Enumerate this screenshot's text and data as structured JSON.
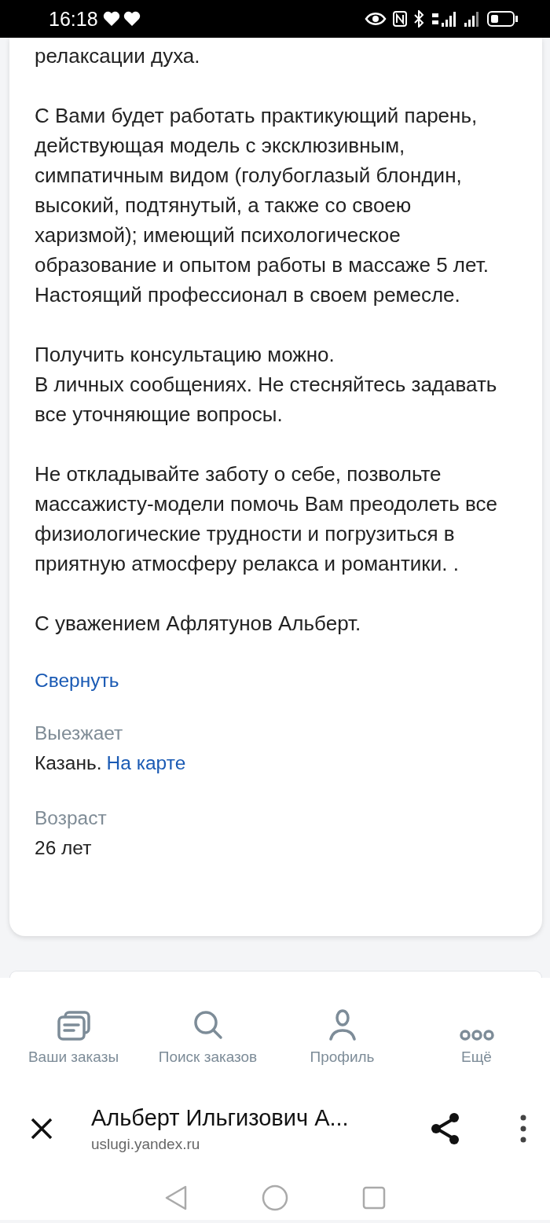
{
  "status_bar": {
    "time": "16:18"
  },
  "description": {
    "paragraphs": [
      "релаксации духа.",
      "С Вами будет работать практикующий парень, действующая модель с эксклюзивным, симпатичным видом (голубоглазый блондин, высокий, подтянутый, а также со своею харизмой); имеющий психологическое образование и опытом работы в массаже 5 лет. Настоящий профессионал в своем ремесле.",
      "Получить консультацию можно.\nВ личных сообщениях. Не стесняйтесь задавать все уточняющие вопросы.",
      "Не откладывайте заботу о себе, позвольте массажисту-модели помочь Вам преодолеть все физиологические трудности и погрузиться в приятную атмосферу релакса и романтики. .",
      "С уважением Афлятунов Альберт."
    ],
    "collapse_link": "Свернуть"
  },
  "fields": [
    {
      "label": "Выезжает",
      "value": "Казань.",
      "link": "На карте"
    },
    {
      "label": "Возраст",
      "value": "26 лет"
    }
  ],
  "bottom_nav": [
    {
      "label": "Ваши заказы",
      "kind": "orders"
    },
    {
      "label": "Поиск заказов",
      "kind": "search"
    },
    {
      "label": "Профиль",
      "kind": "profile"
    },
    {
      "label": "Ещё",
      "kind": "more"
    }
  ],
  "browser_bar": {
    "title": "Альберт Ильгизович А...",
    "url": "uslugi.yandex.ru"
  }
}
